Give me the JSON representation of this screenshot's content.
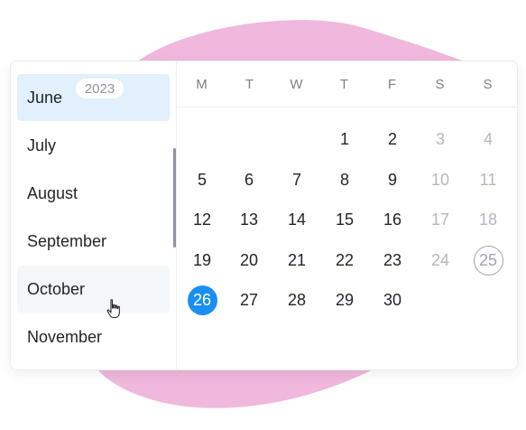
{
  "months": [
    {
      "label": "June",
      "year_badge": "2023"
    },
    {
      "label": "July"
    },
    {
      "label": "August"
    },
    {
      "label": "September"
    },
    {
      "label": "October"
    },
    {
      "label": "November"
    }
  ],
  "weekdays": [
    "M",
    "T",
    "W",
    "T",
    "F",
    "S",
    "S"
  ],
  "weeks": [
    [
      "",
      "",
      "",
      "1",
      "2",
      "3",
      "4"
    ],
    [
      "5",
      "6",
      "7",
      "8",
      "9",
      "10",
      "11"
    ],
    [
      "12",
      "13",
      "14",
      "15",
      "16",
      "17",
      "18"
    ],
    [
      "19",
      "20",
      "21",
      "22",
      "23",
      "24",
      "25"
    ],
    [
      "26",
      "27",
      "28",
      "29",
      "30",
      "",
      ""
    ]
  ],
  "selected_day": "26",
  "today_day": "25",
  "colors": {
    "accent": "#1a8ff0",
    "selected_month_bg": "#e1f0fc",
    "weekend_text": "#b4b8be",
    "background_blob": "#f0b8dc"
  }
}
